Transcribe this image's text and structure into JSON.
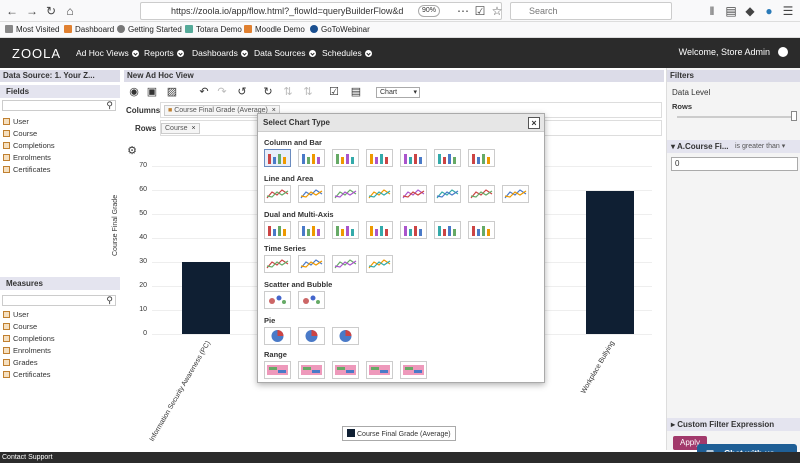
{
  "browser": {
    "url": "https://zoola.io/app/flow.html?_flowId=queryBuilderFlow&d",
    "zoom": "90%",
    "search_placeholder": "Search",
    "bookmarks": [
      "Most Visited",
      "Dashboard",
      "Getting Started",
      "Totara Demo",
      "Moodle Demo",
      "GoToWebinar"
    ]
  },
  "header": {
    "logo": "ZOOLA",
    "menu": [
      "Ad Hoc Views",
      "Reports",
      "Dashboards",
      "Data Sources",
      "Schedules"
    ],
    "welcome": "Welcome, Store Admin"
  },
  "left_panel": {
    "title": "Data Source: 1. Your Z...",
    "fields_title": "Fields",
    "fields": [
      "User",
      "Course",
      "Completions",
      "Enrolments",
      "Certificates"
    ],
    "measures_title": "Measures",
    "measures": [
      "User",
      "Course",
      "Completions",
      "Enrolments",
      "Grades",
      "Certificates"
    ]
  },
  "center": {
    "title": "New Ad Hoc View",
    "chart_select_value": "Chart",
    "columns_label": "Columns",
    "columns_pill": "Course Final Grade (Average)",
    "rows_label": "Rows",
    "rows_pill": "Course",
    "legend_label": "Course Final Grade (Average)",
    "y_axis_label": "Course Final Grade"
  },
  "chart_data": {
    "type": "bar",
    "categories": [
      "Information Security Awareness (PC)",
      "Workplace Bullying"
    ],
    "series": [
      {
        "name": "Course Final Grade (Average)",
        "values": [
          30,
          59.5
        ]
      }
    ],
    "ylabel": "Course Final Grade",
    "ylim": [
      0,
      70
    ],
    "yticks": [
      0,
      10,
      20,
      30,
      40,
      50,
      60,
      70
    ],
    "bar_color": "#0f1f33",
    "partially_hidden": "x_labels_beneath_dialog"
  },
  "dialog": {
    "title": "Select Chart Type",
    "sections": [
      "Column and Bar",
      "Line and Area",
      "Dual and Multi-Axis",
      "Time Series",
      "Scatter and Bubble",
      "Pie",
      "Range"
    ]
  },
  "filters": {
    "title": "Filters",
    "data_level": "Data Level",
    "rows_label": "Rows",
    "filter_field": "A.Course Fi...",
    "operator": "is greater than",
    "value": "0",
    "custom_expr": "Custom Filter Expression",
    "apply": "Apply"
  },
  "chat": {
    "label": "Chat with us"
  },
  "status": {
    "text": "Contact Support"
  },
  "colors": {
    "header_bg": "#2b2b2b",
    "apply": "#a2396b",
    "chat": "#1f5f96",
    "accent": "#6a8bbf"
  }
}
